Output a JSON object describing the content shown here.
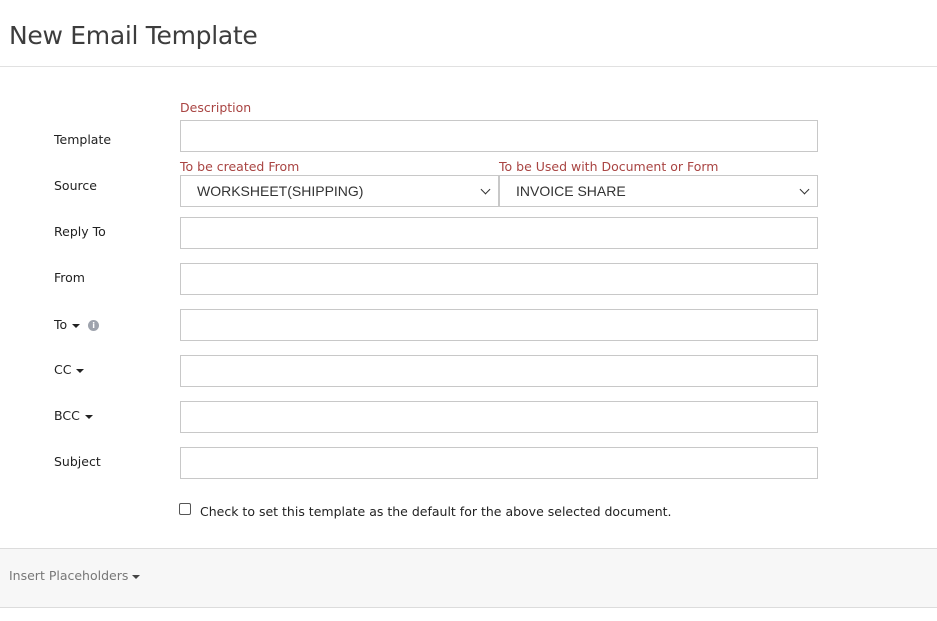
{
  "page": {
    "title": "New Email Template"
  },
  "form": {
    "template": {
      "label": "Template",
      "sublabel": "Description",
      "value": ""
    },
    "source": {
      "label": "Source",
      "created_from_label": "To be created From",
      "created_from_value": "WORKSHEET(SHIPPING)",
      "used_with_label": "To be Used with Document or Form",
      "used_with_value": "INVOICE SHARE"
    },
    "reply_to": {
      "label": "Reply To",
      "value": ""
    },
    "from": {
      "label": "From",
      "value": ""
    },
    "to": {
      "label": "To",
      "value": "",
      "icon": "info-icon"
    },
    "cc": {
      "label": "CC",
      "value": ""
    },
    "bcc": {
      "label": "BCC",
      "value": ""
    },
    "subject": {
      "label": "Subject",
      "value": ""
    },
    "default_checkbox": {
      "label": "Check to set this template as the default for the above selected document.",
      "checked": false
    }
  },
  "placeholders": {
    "label": "Insert Placeholders"
  },
  "colors": {
    "sublabel": "#a94442",
    "border": "#c8c8c8",
    "bar_bg": "#f7f7f7"
  }
}
